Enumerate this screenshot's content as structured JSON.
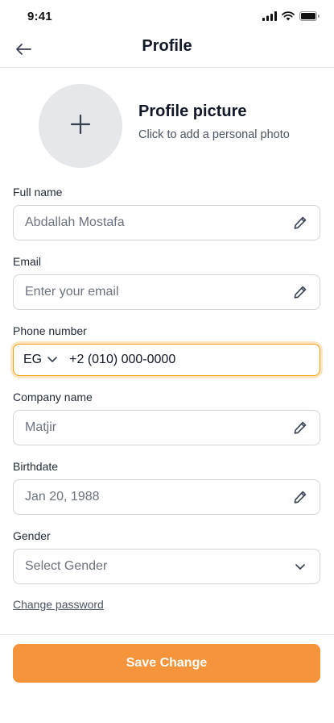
{
  "status_bar": {
    "time": "9:41"
  },
  "header": {
    "title": "Profile"
  },
  "profile_picture": {
    "title": "Profile picture",
    "subtitle": "Click to add a personal photo"
  },
  "form": {
    "full_name": {
      "label": "Full name",
      "value": "Abdallah Mostafa"
    },
    "email": {
      "label": "Email",
      "placeholder": "Enter your email"
    },
    "phone": {
      "label": "Phone number",
      "country": "EG",
      "value": "+2 (010) 000-0000"
    },
    "company": {
      "label": "Company name",
      "value": "Matjir"
    },
    "birthdate": {
      "label": "Birthdate",
      "value": "Jan 20, 1988"
    },
    "gender": {
      "label": "Gender",
      "placeholder": "Select Gender"
    }
  },
  "links": {
    "change_password": "Change password"
  },
  "footer": {
    "save_label": "Save Change"
  },
  "colors": {
    "accent": "#f5943b",
    "focus_border": "#f59e0b"
  },
  "icons": [
    "signal-icon",
    "wifi-icon",
    "battery-icon",
    "back-arrow-icon",
    "plus-icon",
    "pencil-icon",
    "chevron-down-icon"
  ]
}
